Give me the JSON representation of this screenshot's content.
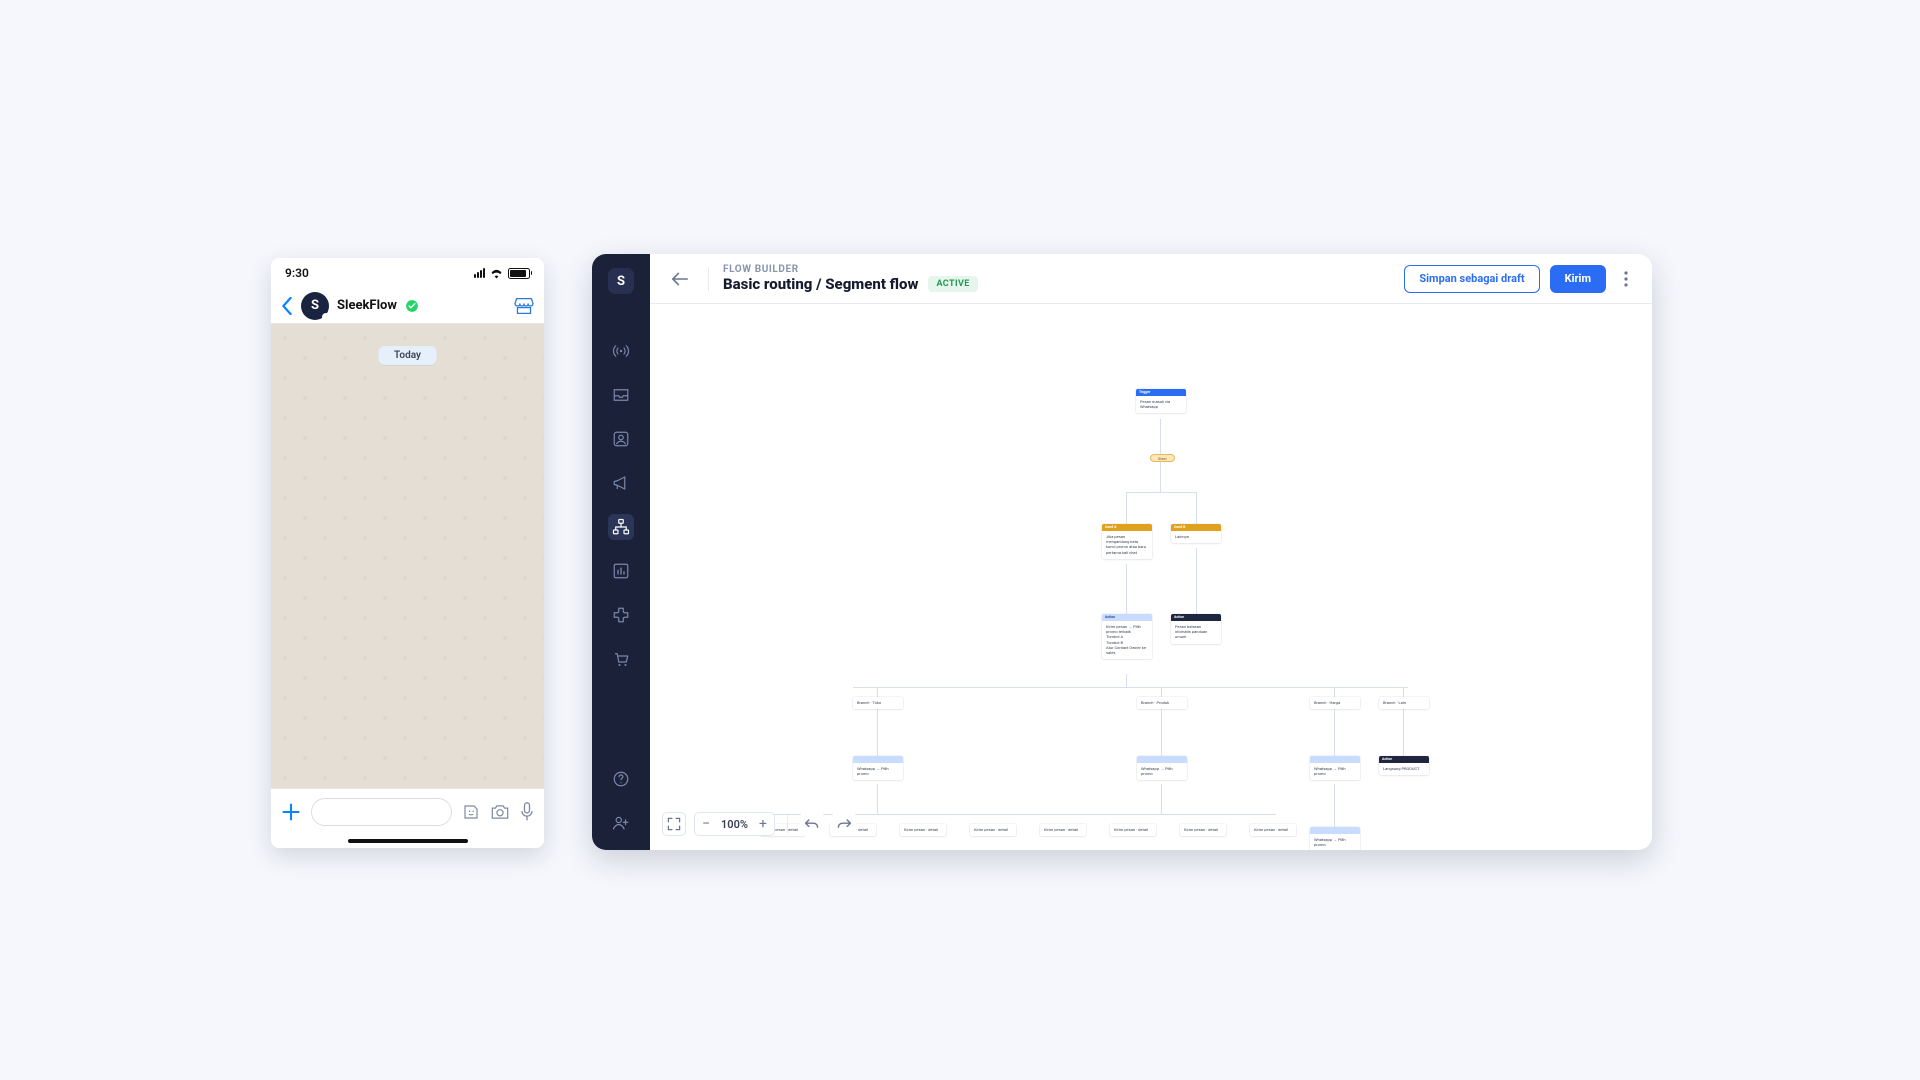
{
  "phone": {
    "time": "9:30",
    "contact_initial": "S",
    "contact_name": "SleekFlow",
    "today_label": "Today"
  },
  "app": {
    "logo_text": "S",
    "breadcrumb": "FLOW BUILDER",
    "title": "Basic routing / Segment flow",
    "status_badge": "ACTIVE",
    "save_draft_label": "Simpan sebagai draft",
    "send_label": "Kirim",
    "zoom_level": "100%",
    "flow": {
      "trigger_head": "Trigger",
      "trigger_body": "Pesan masuk via Whatsapp",
      "start_pill": "Start",
      "cond_left_head": "Cond A",
      "cond_left_body": "Jika pesan mengandung kata kunci promo atau baru pertama kali chat",
      "cond_right_head": "Cond B",
      "cond_right_body": "Lainnya",
      "act_left_head": "Action",
      "act_left_body": "Kirim pesan → Pilih promo terbaik\nTombol A\nTombol B\nAtur Contact Owner ke sales",
      "act_right_head": "Action",
      "act_right_body": "Pesan balasan otomatis panduan umum",
      "b1_head": "Branch · Toko",
      "b2_head": "Branch · Produk",
      "b3_head": "Branch · Harga",
      "b4_head": "Branch · Lain",
      "child_light_body": "Whatsapp → Pilih promo",
      "child_dark_head": "Action",
      "child_dark_body": "Langsung PRODUCT",
      "leaf_body": "Kirim pesan · detail"
    }
  }
}
